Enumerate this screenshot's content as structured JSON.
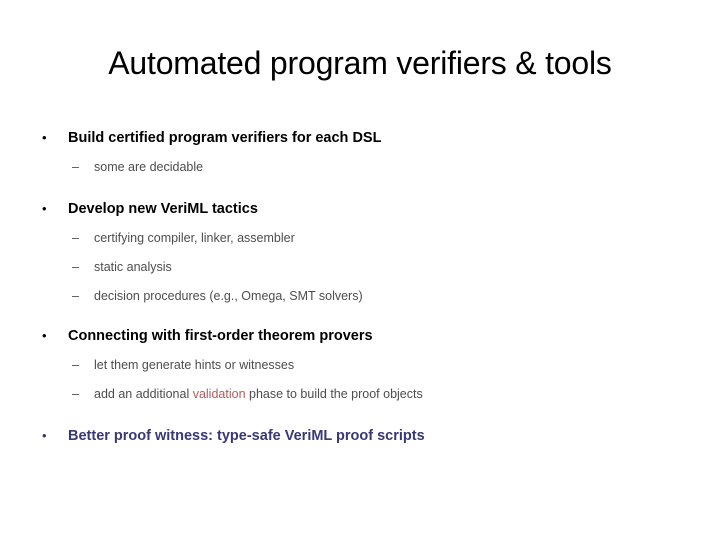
{
  "slide": {
    "title": "Automated program verifiers & tools",
    "colors": {
      "text": "#000000",
      "subtext": "#4d4d4d",
      "highlight_red": "#b25a5a",
      "navy": "#383874",
      "background": "#ffffff"
    },
    "markers": {
      "level1": "•",
      "level2": "–"
    },
    "bullets": [
      {
        "text": "Build certified program verifiers for each DSL",
        "style": "black",
        "sub": [
          {
            "text": "some are decidable"
          }
        ]
      },
      {
        "text": "Develop new VeriML tactics",
        "style": "black",
        "sub": [
          {
            "text": "certifying compiler, linker, assembler"
          },
          {
            "text": "static analysis"
          },
          {
            "text": "decision procedures (e.g., Omega, SMT solvers)"
          }
        ]
      },
      {
        "text": "Connecting with first-order theorem provers",
        "style": "black",
        "sub": [
          {
            "text": "let them generate hints or witnesses"
          },
          {
            "parts": [
              {
                "text": "add an additional ",
                "color": "default"
              },
              {
                "text": "validation",
                "color": "red"
              },
              {
                "text": " phase to build the proof objects",
                "color": "default"
              }
            ]
          }
        ]
      },
      {
        "text": "Better proof witness:  type-safe VeriML proof scripts",
        "style": "navy",
        "sub": []
      }
    ]
  }
}
